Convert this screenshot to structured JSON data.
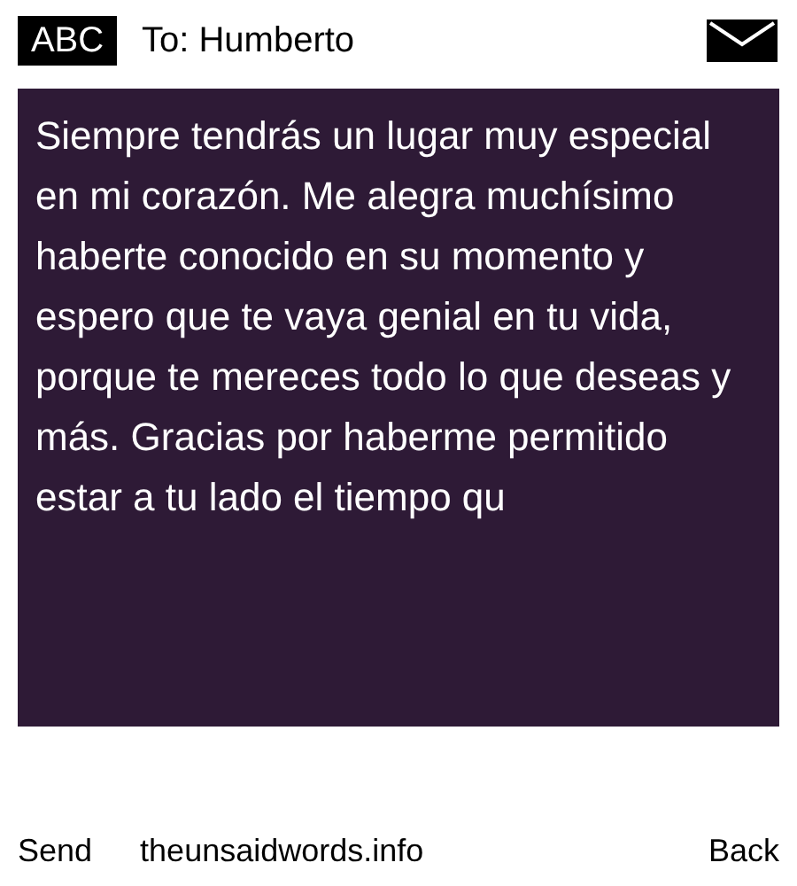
{
  "header": {
    "badge": "ABC",
    "recipient": "To: Humberto"
  },
  "message": {
    "text": "Siempre tendrás un lugar muy especial en mi corazón. Me alegra muchísimo haberte conocido en su momento y espero que te vaya genial en tu vida, porque te mereces todo lo que deseas y más. Gracias por haberme permitido estar a tu lado el tiempo qu"
  },
  "footer": {
    "send": "Send",
    "site": "theunsaidwords.info",
    "back": "Back"
  }
}
